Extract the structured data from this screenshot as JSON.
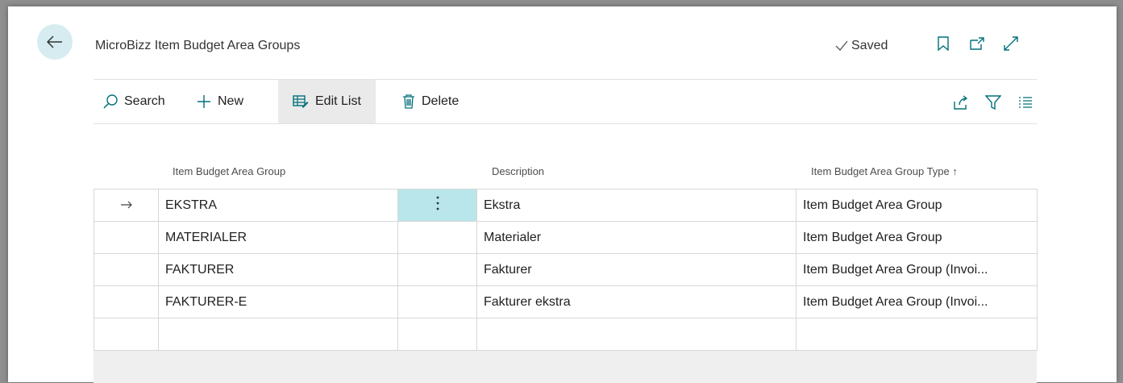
{
  "page": {
    "title": "MicroBizz Item Budget Area Groups",
    "status": "Saved"
  },
  "actions": {
    "search": "Search",
    "new": "New",
    "edit_list": "Edit List",
    "delete": "Delete"
  },
  "columns": {
    "group": "Item Budget Area Group",
    "description": "Description",
    "type": "Item Budget Area Group Type ↑"
  },
  "rows": [
    {
      "group": "EKSTRA",
      "description": "Ekstra",
      "type": "Item Budget Area Group"
    },
    {
      "group": "MATERIALER",
      "description": "Materialer",
      "type": "Item Budget Area Group"
    },
    {
      "group": "FAKTURER",
      "description": "Fakturer",
      "type": "Item Budget Area Group (Invoi..."
    },
    {
      "group": "FAKTURER-E",
      "description": "Fakturer ekstra",
      "type": "Item Budget Area Group (Invoi..."
    }
  ],
  "selected_row": 0,
  "icons": {
    "back": "arrow-left-icon",
    "saved": "checkmark-icon",
    "bookmark": "bookmark-icon",
    "open_new": "open-in-new-window-icon",
    "expand": "expand-icon",
    "share": "share-icon",
    "filter": "filter-icon",
    "list": "list-icon",
    "row_arrow": "row-arrow-icon",
    "more": "more-options-icon"
  },
  "colors": {
    "accent": "#00707a",
    "selected_cell": "#b8e6ea",
    "back_button": "#d7ecf1"
  }
}
